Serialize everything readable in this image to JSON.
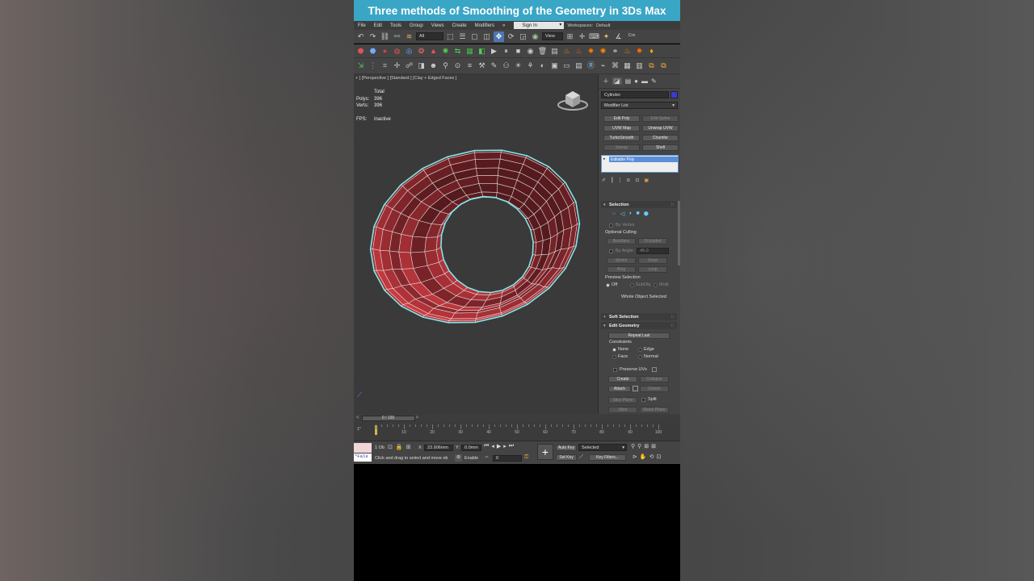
{
  "banner": {
    "title": "Three methods of Smoothing of the Geometry in 3Ds Max"
  },
  "menu": {
    "items": [
      "File",
      "Edit",
      "Tools",
      "Group",
      "Views",
      "Create",
      "Modifiers"
    ],
    "more": "»",
    "sign_in": "Sign In",
    "workspaces_label": "Workspaces:",
    "workspace_value": "Default"
  },
  "toolbar": {
    "filter_value": "All",
    "view_value": "View",
    "create_sel_label": "Cre"
  },
  "viewport": {
    "label": "+ ] [Perspective ] [Standard ] [Clay + Edged Faces ]",
    "stats": {
      "total_label": "Total",
      "polys_label": "Polys:",
      "polys_value": "396",
      "verts_label": "Verts:",
      "verts_value": "396",
      "fps_label": "FPS:",
      "fps_value": "Inactive"
    },
    "mesh_color": "#b9363b",
    "wire_color": "#e8e8e8",
    "selection_outline": "#7fe7ea"
  },
  "command_panel": {
    "object_name": "Cylinder",
    "object_color": "#3a3ad6",
    "modifier_list": "Modifier List",
    "modifier_buttons": [
      "Edit Poly",
      "Edit Spline",
      "UVW Map",
      "Unwrap UVW",
      "TurboSmooth",
      "Chamfer",
      "Sweep",
      "Shell"
    ],
    "stack_item": "Editable Poly",
    "selection": {
      "title": "Selection",
      "by_vertex": "By Vertex",
      "optional_culling": "Optional Culling",
      "backface": "Backface",
      "occluded": "Occluded",
      "by_angle": "By Angle:",
      "angle_value": "45.0",
      "shrink": "Shrink",
      "grow": "Grow",
      "ring": "Ring",
      "loop": "Loop",
      "preview_selection": "Preview Selection",
      "off": "Off",
      "subobj": "SubObj",
      "multi": "Multi",
      "status": "Whole Object Selected"
    },
    "soft_selection": {
      "title": "Soft Selection"
    },
    "edit_geometry": {
      "title": "Edit Geometry",
      "repeat_last": "Repeat Last",
      "constraints": "Constraints",
      "none": "None",
      "edge": "Edge",
      "face": "Face",
      "normal": "Normal",
      "preserve_uvs": "Preserve UVs",
      "create": "Create",
      "collapse": "Collapse",
      "attach": "Attach",
      "detach": "Detach",
      "slice_plane": "Slice Plane",
      "split": "Split",
      "slice": "Slice",
      "reset_plane": "Reset Plane"
    }
  },
  "timeline": {
    "slider": "0 / 100",
    "ticks": [
      "10",
      "20",
      "30",
      "40",
      "50",
      "60",
      "70",
      "80",
      "90",
      "100"
    ]
  },
  "status": {
    "selected_count": "1 Ob",
    "prompt": "Click and drag to select and move ob",
    "x_label": "X:",
    "x_value": "23.906mm",
    "y_label": "Y:",
    "y_value": "0.0mm",
    "enable": "Enable",
    "auto_key": "Auto Key",
    "set_key": "Set Key",
    "selected": "Selected",
    "key_filters": "Key Filters...",
    "frame_value": "0",
    "script_text": "*Fals"
  }
}
